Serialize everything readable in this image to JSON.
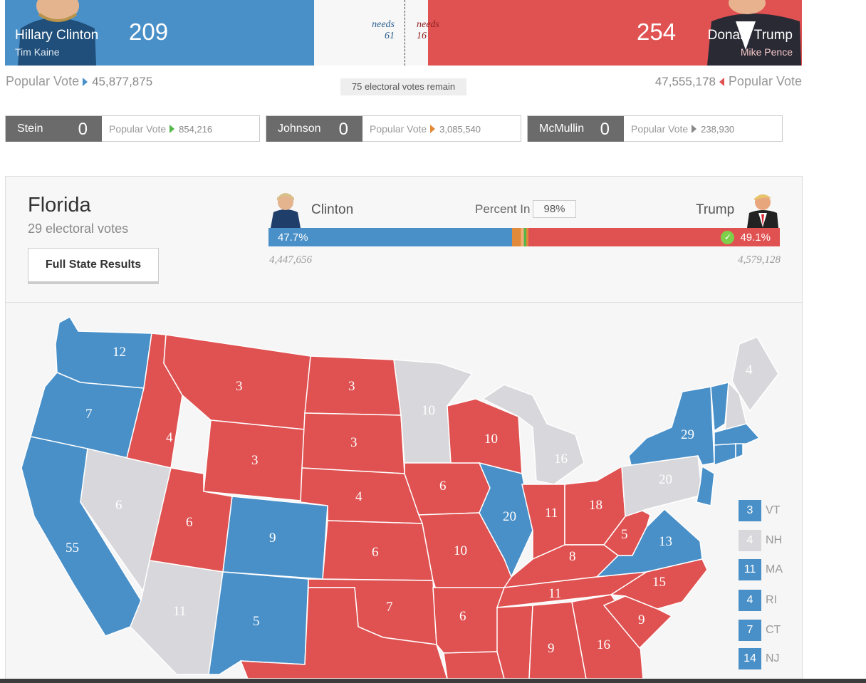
{
  "clinton": {
    "name": "Hillary Clinton",
    "vp": "Tim Kaine",
    "electoral_votes": "209",
    "needs_label": "needs",
    "needs_value": "61",
    "popular_vote_label": "Popular Vote",
    "popular_vote": "45,877,875"
  },
  "trump": {
    "name": "Donald Trump",
    "vp": "Mike Pence",
    "electoral_votes": "254",
    "needs_label": "needs",
    "needs_value": "16",
    "popular_vote_label": "Popular Vote",
    "popular_vote": "47,555,178"
  },
  "remaining": "75 electoral votes remain",
  "third_party": [
    {
      "name": "Stein",
      "ev": "0",
      "pv_label": "Popular Vote",
      "pv": "854,216"
    },
    {
      "name": "Johnson",
      "ev": "0",
      "pv_label": "Popular Vote",
      "pv": "3,085,540"
    },
    {
      "name": "McMullin",
      "ev": "0",
      "pv_label": "Popular Vote",
      "pv": "238,930"
    }
  ],
  "state": {
    "title": "Florida",
    "ev_label": "29 electoral votes",
    "button": "Full State Results",
    "left_name": "Clinton",
    "right_name": "Trump",
    "percent_in_label": "Percent In",
    "percent_in": "98%",
    "left_pct": "47.7%",
    "right_pct": "49.1%",
    "left_votes": "4,447,656",
    "right_votes": "4,579,128",
    "bar_fractions": {
      "clinton": 0.477,
      "other": 0.032,
      "trump": 0.491
    }
  },
  "colors": {
    "dem": "#4a90c8",
    "rep": "#e05252",
    "undecided": "#d8d8dc"
  },
  "map_labels": [
    "12",
    "7",
    "55",
    "6",
    "4",
    "3",
    "3",
    "6",
    "9",
    "5",
    "11",
    "3",
    "3",
    "4",
    "6",
    "7",
    "10",
    "6",
    "6",
    "10",
    "20",
    "11",
    "18",
    "16",
    "10",
    "8",
    "11",
    "5",
    "13",
    "9",
    "15",
    "9",
    "16",
    "20",
    "29",
    "4"
  ],
  "legend": [
    {
      "votes": "3",
      "state": "VT",
      "party": "dem"
    },
    {
      "votes": "4",
      "state": "NH",
      "party": "undecided"
    },
    {
      "votes": "11",
      "state": "MA",
      "party": "dem"
    },
    {
      "votes": "4",
      "state": "RI",
      "party": "dem"
    },
    {
      "votes": "7",
      "state": "CT",
      "party": "dem"
    },
    {
      "votes": "14",
      "state": "NJ",
      "party": "dem"
    }
  ]
}
